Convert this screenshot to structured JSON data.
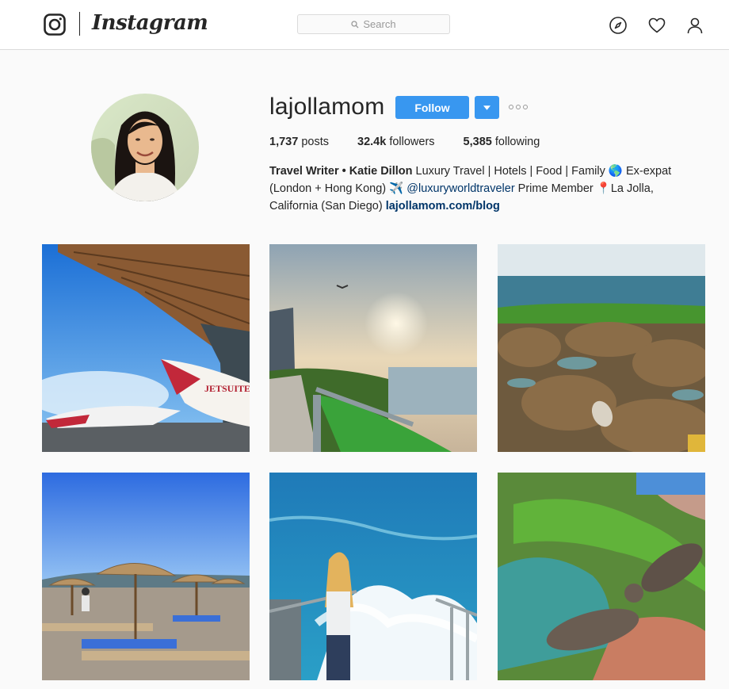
{
  "nav": {
    "logo_text": "Instagram",
    "search_placeholder": "Search",
    "icons": [
      "camera-logo-icon",
      "search-icon",
      "compass-icon",
      "heart-icon",
      "person-icon"
    ]
  },
  "profile": {
    "username": "lajollamom",
    "follow_label": "Follow",
    "stats": {
      "posts_count": "1,737",
      "posts_label": "posts",
      "followers_count": "32.4k",
      "followers_label": "followers",
      "following_count": "5,385",
      "following_label": "following"
    },
    "bio": {
      "name": "Travel Writer • Katie Dillon",
      "text1": " Luxury Travel | Hotels | Food | Family 🌎 Ex-expat (London + Hong Kong) ✈️ ",
      "mention": "@luxuryworldtraveler",
      "text2": " Prime Member 📍La Jolla, California (San Diego) ",
      "website": "lajollamom.com/blog"
    }
  },
  "colors": {
    "accent": "#3897f0",
    "link": "#003569",
    "text": "#262626",
    "background": "#fafafa"
  },
  "grid": {
    "posts": [
      {
        "subject": "private jet in hangar"
      },
      {
        "subject": "sunset over coastal path"
      },
      {
        "subject": "sea lion on rocky tide pools"
      },
      {
        "subject": "beach umbrellas on pebbled shore"
      },
      {
        "subject": "girl watching ocean waves from railing"
      },
      {
        "subject": "sea lions on green mossy rocks"
      }
    ]
  }
}
